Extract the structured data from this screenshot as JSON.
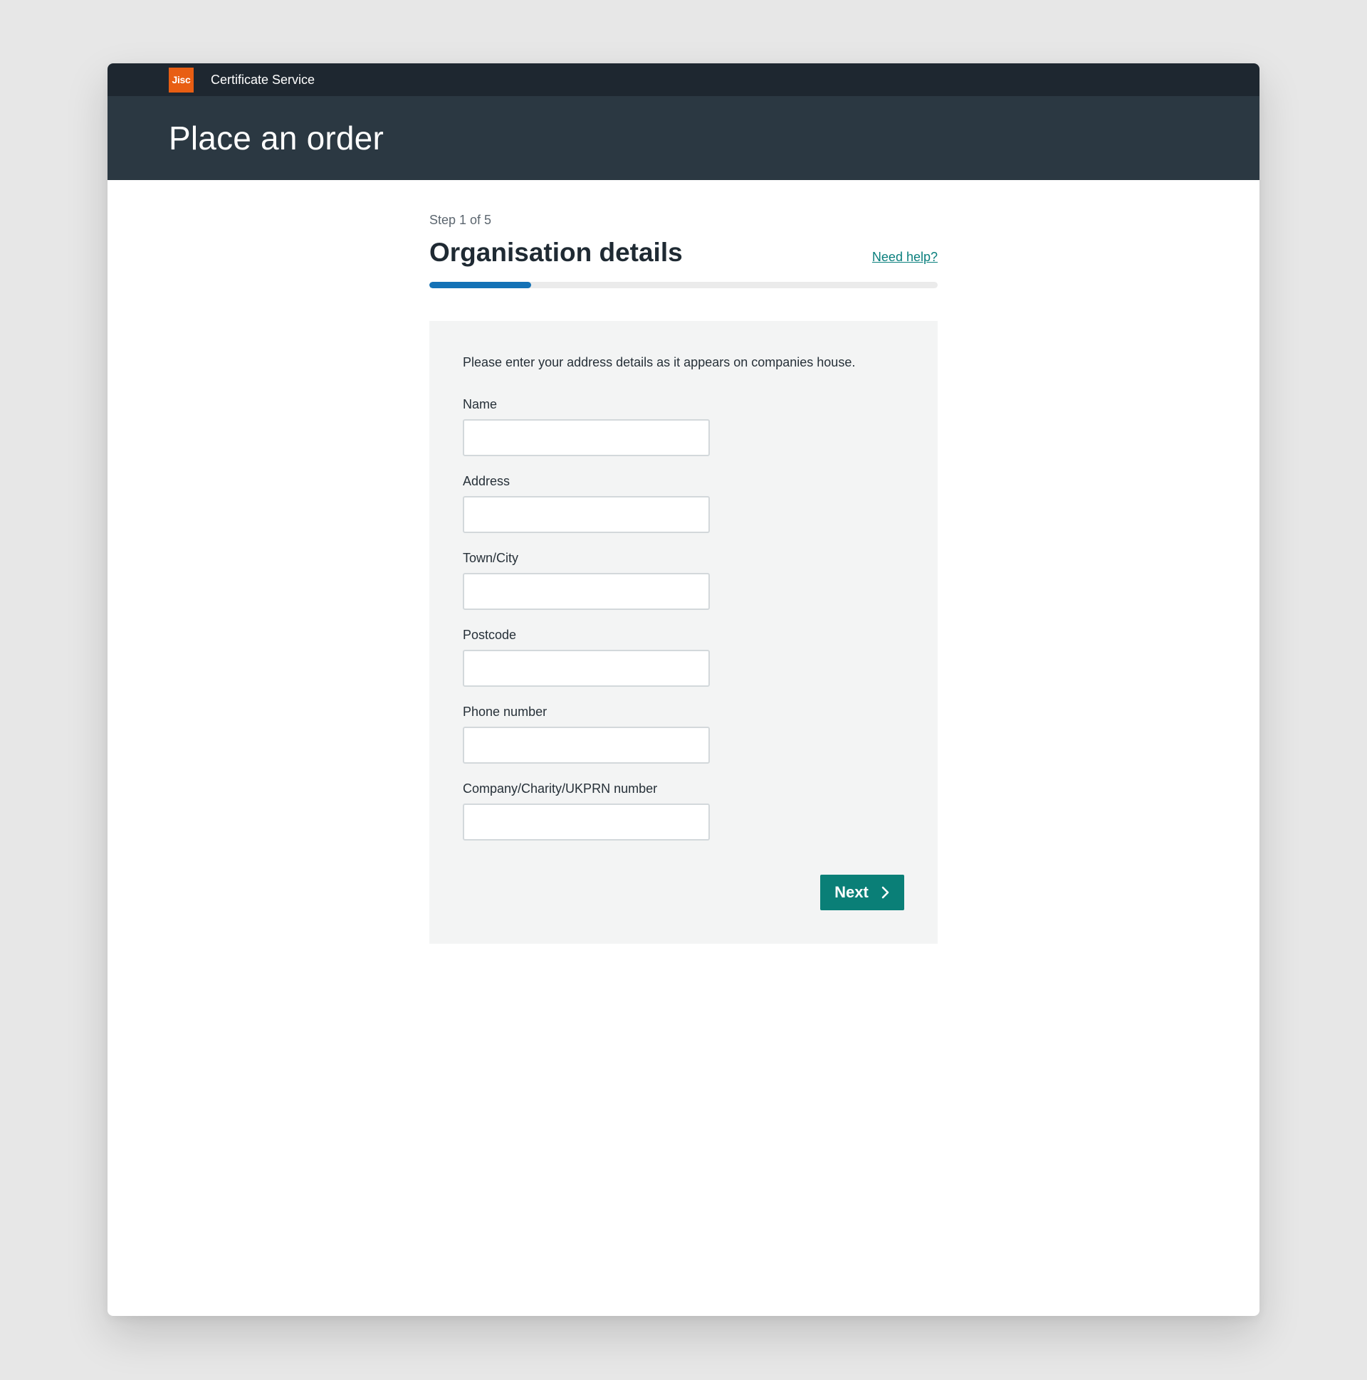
{
  "header": {
    "logo_text": "Jisc",
    "service_name": "Certificate Service",
    "page_title": "Place an order"
  },
  "step": {
    "label": "Step 1 of 5",
    "title": "Organisation details",
    "help_link": "Need help?",
    "progress_fraction": 0.2,
    "progress_color": "#1472b6"
  },
  "form": {
    "intro": "Please enter your address details as it appears on companies house.",
    "fields": [
      {
        "label": "Name",
        "value": ""
      },
      {
        "label": "Address",
        "value": ""
      },
      {
        "label": "Town/City",
        "value": ""
      },
      {
        "label": "Postcode",
        "value": ""
      },
      {
        "label": "Phone number",
        "value": ""
      },
      {
        "label": "Company/Charity/UKPRN number",
        "value": ""
      }
    ],
    "next_label": "Next",
    "next_icon": "chevron-right-icon"
  },
  "colors": {
    "brand": "#e85e13",
    "topbar": "#1e2730",
    "hero": "#2b3842",
    "accent": "#0a7f77"
  }
}
